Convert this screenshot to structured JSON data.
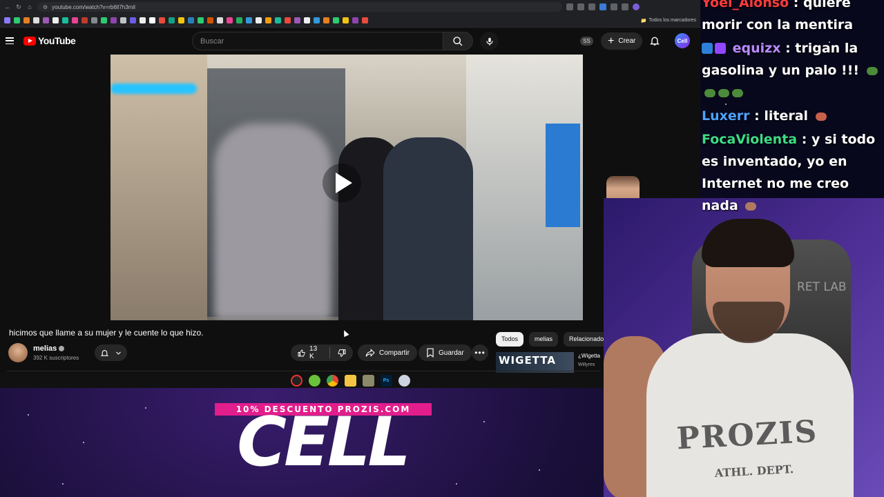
{
  "browser": {
    "url": "youtube.com/watch?v=rb6ll7h3mil",
    "bookmarks_all_label": "Todos los marcadores"
  },
  "youtube": {
    "logo_text": "YouTube",
    "search_placeholder": "Buscar",
    "ss_badge": "SS",
    "create_label": "Crear",
    "avatar_text": "Cell"
  },
  "video": {
    "title": "hicimos que llame a su mujer y le cuente lo que hizo.",
    "channel_name": "melias",
    "subscribers": "392 K suscriptores",
    "likes": "13 K",
    "share_label": "Compartir",
    "save_label": "Guardar"
  },
  "sidebar": {
    "chips": [
      "Todos",
      "melias",
      "Relacionado"
    ],
    "rec_thumb_text": "WIGETTA",
    "rec_title": "¿Wigetta",
    "rec_channel": "Willyrex"
  },
  "promo": {
    "discount": "10% DESCUENTO PROZIS.COM",
    "brand": "CELL"
  },
  "emote": {
    "label": "x2"
  },
  "chat": [
    {
      "user": "Yoel_Alonso",
      "user_color": "#ff3b3b",
      "text": "quiere morir con la mentira"
    },
    {
      "user": "equizx",
      "user_color": "#b98bff",
      "text": "trigan la gasolina y un palo !!!"
    },
    {
      "user": "Luxerr",
      "user_color": "#4da3ff",
      "text": "literal"
    },
    {
      "user": "FocaViolenta",
      "user_color": "#3ddc84",
      "text": "y si todo es inventado, yo en Internet no me creo nada"
    }
  ],
  "webcam": {
    "chair_text": "RET LAB",
    "shirt_text": "PROZIS",
    "shirt_sub": "ATHL. DEPT."
  },
  "colors": {
    "youtube_red": "#ff0000",
    "promo_pink": "#e21d8c",
    "yt_bg": "#0f0f0f"
  }
}
